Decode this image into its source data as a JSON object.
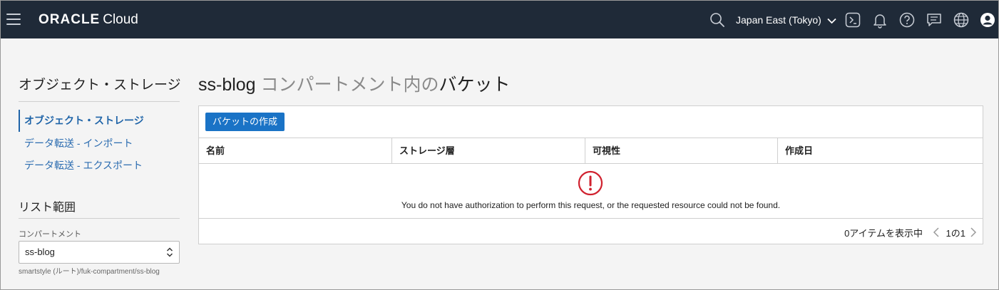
{
  "header": {
    "brand_oracle": "ORACLE",
    "brand_cloud": "Cloud",
    "region": "Japan East (Tokyo)",
    "icons": [
      "menu-icon",
      "search-icon",
      "chevron-down-icon",
      "cloud-shell-icon",
      "bell-icon",
      "help-icon",
      "chat-icon",
      "globe-icon",
      "user-icon"
    ]
  },
  "sidebar": {
    "title": "オブジェクト・ストレージ",
    "items": [
      {
        "label": "オブジェクト・ストレージ",
        "active": true
      },
      {
        "label": "データ転送 - インポート",
        "active": false
      },
      {
        "label": "データ転送 - エクスポート",
        "active": false
      }
    ],
    "scope": {
      "title": "リスト範囲",
      "compartment_label": "コンパートメント",
      "compartment_value": "ss-blog",
      "compartment_path": "smartstyle (ルート)/fuk-compartment/ss-blog"
    }
  },
  "main": {
    "title_name": "ss-blog",
    "title_middle": " コンパートメント内の",
    "title_end": "バケット",
    "create_button": "バケットの作成",
    "columns": [
      "名前",
      "ストレージ層",
      "可視性",
      "作成日"
    ],
    "error_message": "You do not have authorization to perform this request, or the requested resource could not be found.",
    "count_text": "0アイテムを表示中",
    "page_text": "1の1"
  },
  "colors": {
    "topbar": "#1f2a38",
    "link": "#2b6cb0",
    "primary_button": "#1a73c6",
    "error": "#d0212e"
  }
}
